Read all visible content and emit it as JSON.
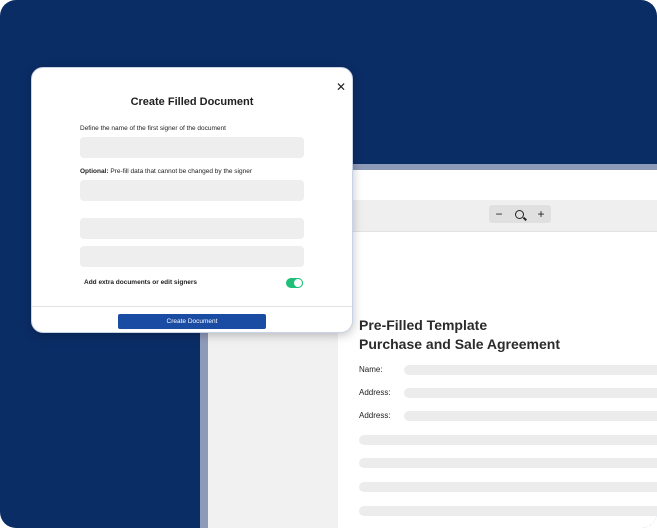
{
  "viewer": {
    "zoom_out_symbol": "−",
    "zoom_in_symbol": "+",
    "zoom_icon": "search-icon",
    "document": {
      "title_line1": "Pre-Filled Template",
      "title_line2": "Purchase and Sale Agreement",
      "fields": [
        {
          "label": "Name:"
        },
        {
          "label": "Address:"
        },
        {
          "label": "Address:"
        }
      ]
    }
  },
  "modal": {
    "title": "Create Filled Document",
    "close_symbol": "✕",
    "signer_label": "Define the name of the first signer of the document",
    "optional_label_bold": "Optional:",
    "optional_label_rest": " Pre-fill data that cannot be changed by the signer",
    "toggle_label": "Add extra documents or edit signers",
    "toggle_on": true,
    "primary_button": "Create Document"
  },
  "colors": {
    "background": "#0b2d66",
    "primary_button": "#1a4ca3",
    "toggle_on": "#1fbf7a"
  }
}
